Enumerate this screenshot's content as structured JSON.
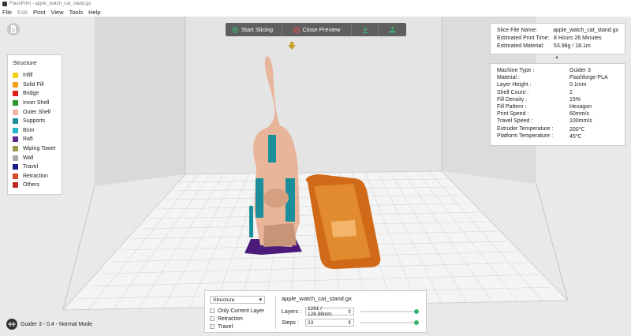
{
  "window": {
    "title": "FlashPrint - apple_watch_cat_stand.gx"
  },
  "menu": {
    "items": [
      "File",
      "Edit",
      "Print",
      "View",
      "Tools",
      "Help"
    ]
  },
  "toolbar": {
    "start_slicing": "Start Slicing",
    "close_preview": "Close Preview"
  },
  "legend": {
    "title": "Structure",
    "items": [
      {
        "label": "Infill",
        "color": "#f2d11a"
      },
      {
        "label": "Solid Fill",
        "color": "#f0a020"
      },
      {
        "label": "Bridge",
        "color": "#e0201e"
      },
      {
        "label": "Inner Shell",
        "color": "#2a9a2a"
      },
      {
        "label": "Outer Shell",
        "color": "#f2b2a0"
      },
      {
        "label": "Supports",
        "color": "#1a8f9a"
      },
      {
        "label": "Brim",
        "color": "#20b8c8"
      },
      {
        "label": "Raft",
        "color": "#5a2a8a"
      },
      {
        "label": "Wiping Tower",
        "color": "#9a9a4a"
      },
      {
        "label": "Wall",
        "color": "#a8a8a8"
      },
      {
        "label": "Travel",
        "color": "#1a1a8a"
      },
      {
        "label": "Retraction",
        "color": "#d84a2a"
      },
      {
        "label": "Others",
        "color": "#c02a20"
      }
    ]
  },
  "slice_info": {
    "rows": [
      {
        "key": "Slice File Name:",
        "value": "apple_watch_cat_stand.gx"
      },
      {
        "key": "Estimated Print Time:",
        "value": "8 Hours 26 Minutes"
      },
      {
        "key": "Estimated Material:",
        "value": "53.98g / 18.1m"
      }
    ]
  },
  "params": {
    "rows": [
      {
        "key": "Machine Type :",
        "value": "Guider 3"
      },
      {
        "key": "Material :",
        "value": "Flashforge-PLA"
      },
      {
        "key": "Layer Height :",
        "value": "0.1mm"
      },
      {
        "key": "Shell Count :",
        "value": "2"
      },
      {
        "key": "Fill Density :",
        "value": "15%"
      },
      {
        "key": "Fill Pattern :",
        "value": "Hexagon"
      },
      {
        "key": "Print Speed :",
        "value": "60mm/s"
      },
      {
        "key": "Travel Speed :",
        "value": "100mm/s"
      },
      {
        "key": "Extruder Temperature :",
        "value": "200℃"
      },
      {
        "key": "Platform Temperature :",
        "value": "45℃"
      }
    ]
  },
  "preview": {
    "mode_select": "Structure",
    "only_current_layer": "Only Current Layer",
    "retraction": "Retraction",
    "travel": "Travel",
    "file_name": "apple_watch_cat_stand.gx",
    "layers_label": "Layers :",
    "layers_value": "1261 / 126.98mm",
    "steps_label": "Steps :",
    "steps_value": "23",
    "layers_progress": 1.0,
    "steps_progress": 1.0
  },
  "status": {
    "machine": "Guider 3 - 0.4 - Normal Mode"
  }
}
